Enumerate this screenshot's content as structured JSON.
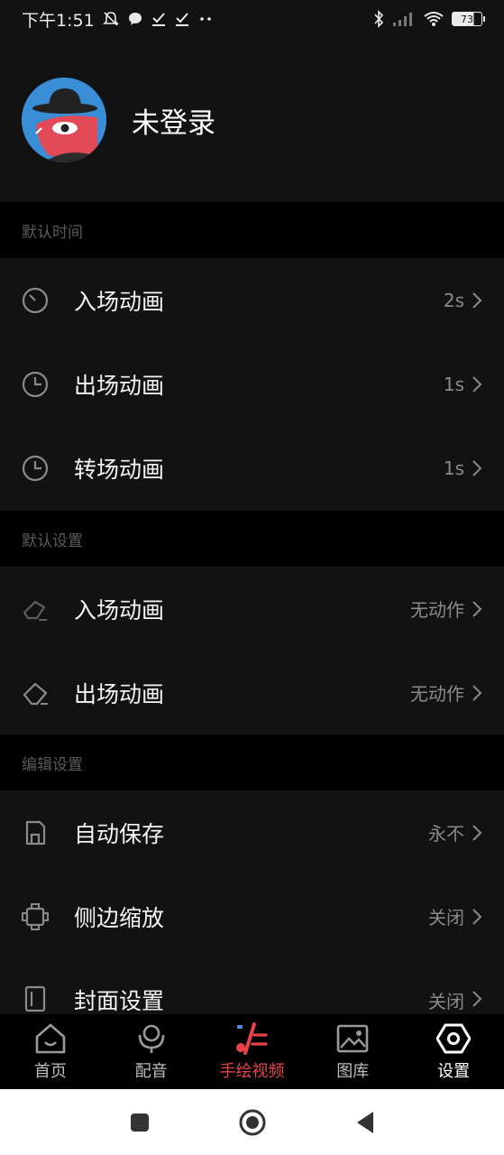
{
  "status": {
    "time": "下午1:51",
    "battery": "73",
    "left_icons": [
      "mute-bell-icon",
      "chat-bubble-icon",
      "check-icon",
      "check-icon",
      "more-dots-icon"
    ],
    "right_icons": [
      "bluetooth-icon",
      "signal-icon",
      "wifi-icon",
      "battery-icon"
    ]
  },
  "profile": {
    "name": "未登录"
  },
  "sections": {
    "time": {
      "title": "默认时间",
      "items": [
        {
          "label": "入场动画",
          "value": "2s",
          "icon": "clock-icon"
        },
        {
          "label": "出场动画",
          "value": "1s",
          "icon": "clock-icon"
        },
        {
          "label": "转场动画",
          "value": "1s",
          "icon": "clock-icon"
        }
      ]
    },
    "settings": {
      "title": "默认设置",
      "items": [
        {
          "label": "入场动画",
          "value": "无动作",
          "icon": "eraser-icon"
        },
        {
          "label": "出场动画",
          "value": "无动作",
          "icon": "eraser-icon"
        }
      ]
    },
    "edit": {
      "title": "编辑设置",
      "items": [
        {
          "label": "自动保存",
          "value": "永不",
          "icon": "save-icon"
        },
        {
          "label": "侧边缩放",
          "value": "关闭",
          "icon": "scale-icon"
        },
        {
          "label": "封面设置",
          "value": "关闭",
          "icon": "cover-icon"
        }
      ]
    }
  },
  "tabs": [
    {
      "label": "首页",
      "icon": "home-icon"
    },
    {
      "label": "配音",
      "icon": "microphone-icon"
    },
    {
      "label": "手绘视频",
      "icon": "draw-video-icon"
    },
    {
      "label": "图库",
      "icon": "gallery-icon"
    },
    {
      "label": "设置",
      "icon": "settings-icon"
    }
  ],
  "colors": {
    "accent": "#e8434b",
    "background": "#121212",
    "section_bg": "#000000",
    "muted": "#8a8a8a"
  }
}
